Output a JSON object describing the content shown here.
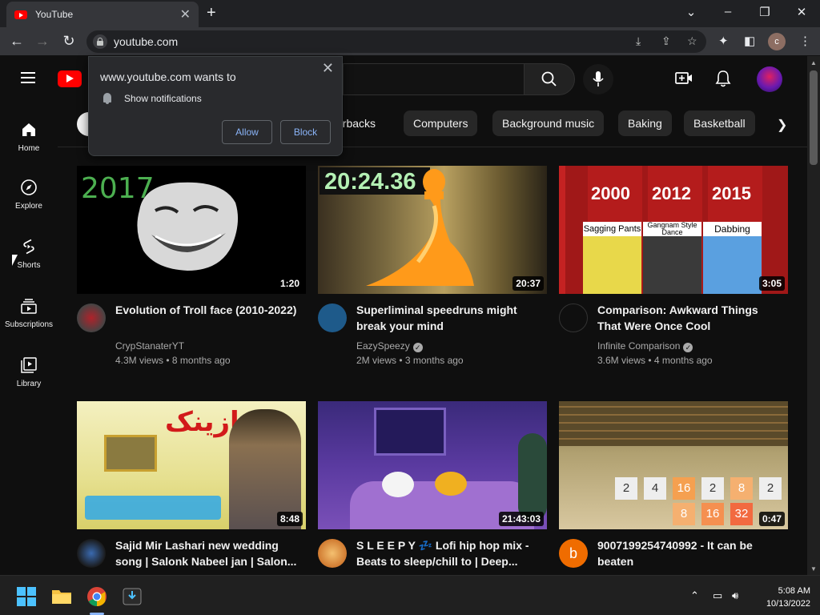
{
  "browser": {
    "tab_title": "YouTube",
    "url": "youtube.com",
    "profile_initial": "c"
  },
  "permission_prompt": {
    "title": "www.youtube.com wants to",
    "permission": "Show notifications",
    "allow_label": "Allow",
    "block_label": "Block"
  },
  "sidebar": {
    "items": [
      {
        "label": "Home"
      },
      {
        "label": "Explore"
      },
      {
        "label": "Shorts"
      },
      {
        "label": "Subscriptions"
      },
      {
        "label": "Library"
      }
    ]
  },
  "chips": [
    "erbacks",
    "Computers",
    "Background music",
    "Baking",
    "Basketball"
  ],
  "videos": [
    {
      "title": "Evolution of Troll face (2010-2022)",
      "channel": "CrypStanaterYT",
      "verified": false,
      "meta": "4.3M views • 8 months ago",
      "duration": "1:20",
      "thumb_text": "2017"
    },
    {
      "title": "Superliminal speedruns might break your mind",
      "channel": "EazySpeezy",
      "verified": true,
      "meta": "2M views • 3 months ago",
      "duration": "20:37",
      "thumb_text": "20:24.36"
    },
    {
      "title": "Comparison: Awkward Things That Were Once Cool",
      "channel": "Infinite Comparison",
      "verified": true,
      "meta": "3.6M views • 4 months ago",
      "duration": "3:05",
      "thumb_text": [
        "2000",
        "2012",
        "2015"
      ],
      "thumb_captions": [
        "Sagging Pants",
        "Gangnam Style Dance",
        "Dabbing"
      ]
    },
    {
      "title": "Sajid Mir Lashari new wedding song | Salonk Nabeel jan | Salon...",
      "channel": "",
      "verified": false,
      "meta": "",
      "duration": "8:48",
      "thumb_text": "نازینک"
    },
    {
      "title": "S L E E P Y 💤 Lofi hip hop mix - Beats to sleep/chill to | Deep...",
      "channel": "",
      "verified": false,
      "meta": "",
      "duration": "21:43:03"
    },
    {
      "title": "9007199254740992 - It can be beaten",
      "channel": "",
      "verified": false,
      "meta": "",
      "duration": "0:47",
      "avatar_letter": "b",
      "thumb_tiles": [
        "2",
        "4",
        "16",
        "2",
        "8",
        "2",
        "8",
        "16",
        "32"
      ]
    }
  ],
  "taskbar": {
    "time": "5:08 AM",
    "date": "10/13/2022"
  },
  "colors": {
    "youtube_red": "#ff0000",
    "background": "#0f0f0f",
    "chip_bg": "#272727",
    "link_blue": "#8ab4f8"
  }
}
